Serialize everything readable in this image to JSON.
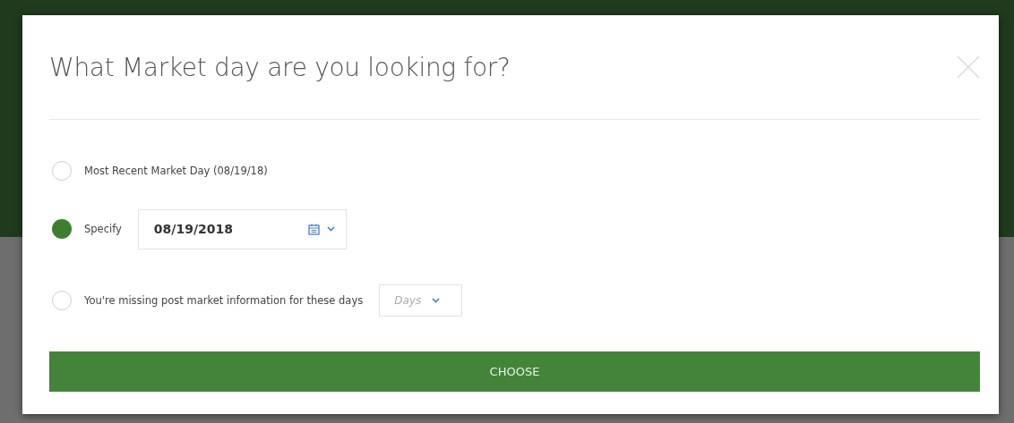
{
  "dialog": {
    "title": "What Market day are you looking for?",
    "options": [
      {
        "kind": "plain",
        "label": "Most Recent Market Day (08/19/18)",
        "selected": false
      },
      {
        "kind": "date",
        "label": "Specify",
        "selected": true,
        "value": "08/19/2018"
      },
      {
        "kind": "select",
        "label": "You're missing post market information for these days",
        "selected": false,
        "placeholder": "Days"
      }
    ],
    "button": "CHOOSE"
  }
}
